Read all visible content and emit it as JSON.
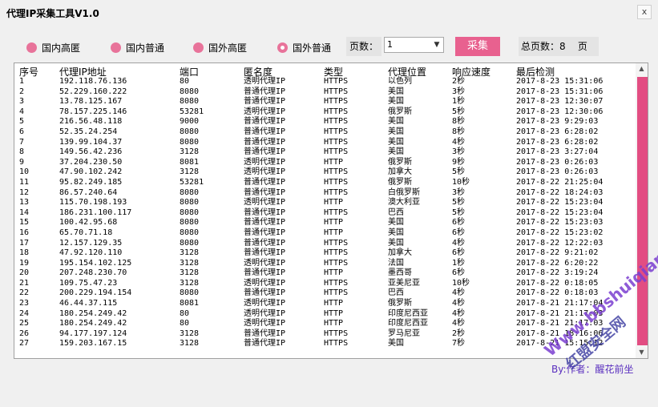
{
  "window": {
    "title": "代理IP采集工具V1.0",
    "close_label": "x"
  },
  "filters": [
    {
      "label": "国内高匿",
      "selected": false
    },
    {
      "label": "国内普通",
      "selected": false
    },
    {
      "label": "国外高匿",
      "selected": false
    },
    {
      "label": "国外普通",
      "selected": true
    }
  ],
  "page_label": "页数：",
  "page_select": {
    "value": "1"
  },
  "collect_button": "采集",
  "total_pages": {
    "prefix": "总页数：",
    "value": "8",
    "suffix": "页"
  },
  "table": {
    "columns": [
      "序号",
      "代理IP地址",
      "端口",
      "匿名度",
      "类型",
      "代理位置",
      "响应速度",
      "最后检测"
    ],
    "rows": [
      [
        "1",
        "192.118.76.136",
        "80",
        "透明代理IP",
        "HTTPS",
        "以色列",
        "2秒",
        "2017-8-23 15:31:06"
      ],
      [
        "2",
        "52.229.160.222",
        "8080",
        "普通代理IP",
        "HTTPS",
        "美国",
        "3秒",
        "2017-8-23 15:31:06"
      ],
      [
        "3",
        "13.78.125.167",
        "8080",
        "普通代理IP",
        "HTTPS",
        "美国",
        "1秒",
        "2017-8-23 12:30:07"
      ],
      [
        "4",
        "78.157.225.146",
        "53281",
        "透明代理IP",
        "HTTPS",
        "俄罗斯",
        "5秒",
        "2017-8-23 12:30:06"
      ],
      [
        "5",
        "216.56.48.118",
        "9000",
        "普通代理IP",
        "HTTPS",
        "美国",
        "8秒",
        "2017-8-23 9:29:03"
      ],
      [
        "6",
        "52.35.24.254",
        "8080",
        "普通代理IP",
        "HTTPS",
        "美国",
        "8秒",
        "2017-8-23 6:28:02"
      ],
      [
        "7",
        "139.99.104.37",
        "8080",
        "普通代理IP",
        "HTTPS",
        "美国",
        "4秒",
        "2017-8-23 6:28:02"
      ],
      [
        "8",
        "149.56.42.236",
        "3128",
        "普通代理IP",
        "HTTPS",
        "美国",
        "3秒",
        "2017-8-23 3:27:04"
      ],
      [
        "9",
        "37.204.230.50",
        "8081",
        "透明代理IP",
        "HTTP",
        "俄罗斯",
        "9秒",
        "2017-8-23 0:26:03"
      ],
      [
        "10",
        "47.90.102.242",
        "3128",
        "透明代理IP",
        "HTTPS",
        "加拿大",
        "5秒",
        "2017-8-23 0:26:03"
      ],
      [
        "11",
        "95.82.249.185",
        "53281",
        "普通代理IP",
        "HTTPS",
        "俄罗斯",
        "10秒",
        "2017-8-22 21:25:04"
      ],
      [
        "12",
        "86.57.240.64",
        "8080",
        "普通代理IP",
        "HTTPS",
        "白俄罗斯",
        "3秒",
        "2017-8-22 18:24:03"
      ],
      [
        "13",
        "115.70.198.193",
        "8080",
        "透明代理IP",
        "HTTP",
        "澳大利亚",
        "5秒",
        "2017-8-22 15:23:04"
      ],
      [
        "14",
        "186.231.100.117",
        "8080",
        "普通代理IP",
        "HTTPS",
        "巴西",
        "5秒",
        "2017-8-22 15:23:04"
      ],
      [
        "15",
        "100.42.95.68",
        "8080",
        "普通代理IP",
        "HTTP",
        "美国",
        "6秒",
        "2017-8-22 15:23:03"
      ],
      [
        "16",
        "65.70.71.18",
        "8080",
        "普通代理IP",
        "HTTP",
        "美国",
        "6秒",
        "2017-8-22 15:23:02"
      ],
      [
        "17",
        "12.157.129.35",
        "8080",
        "普通代理IP",
        "HTTPS",
        "美国",
        "4秒",
        "2017-8-22 12:22:03"
      ],
      [
        "18",
        "47.92.120.110",
        "3128",
        "普通代理IP",
        "HTTPS",
        "加拿大",
        "6秒",
        "2017-8-22 9:21:02"
      ],
      [
        "19",
        "195.154.102.125",
        "3128",
        "透明代理IP",
        "HTTPS",
        "法国",
        "1秒",
        "2017-8-22 6:20:22"
      ],
      [
        "20",
        "207.248.230.70",
        "3128",
        "普通代理IP",
        "HTTP",
        "墨西哥",
        "6秒",
        "2017-8-22 3:19:24"
      ],
      [
        "21",
        "109.75.47.23",
        "3128",
        "透明代理IP",
        "HTTPS",
        "亚美尼亚",
        "10秒",
        "2017-8-22 0:18:05"
      ],
      [
        "22",
        "200.229.194.154",
        "8080",
        "普通代理IP",
        "HTTPS",
        "巴西",
        "4秒",
        "2017-8-22 0:18:03"
      ],
      [
        "23",
        "46.44.37.115",
        "8081",
        "透明代理IP",
        "HTTP",
        "俄罗斯",
        "4秒",
        "2017-8-21 21:17:04"
      ],
      [
        "24",
        "180.254.249.42",
        "80",
        "透明代理IP",
        "HTTP",
        "印度尼西亚",
        "4秒",
        "2017-8-21 21:17:03"
      ],
      [
        "25",
        "180.254.249.42",
        "80",
        "透明代理IP",
        "HTTP",
        "印度尼西亚",
        "4秒",
        "2017-8-21 21:17:03"
      ],
      [
        "26",
        "94.177.197.124",
        "3128",
        "普通代理IP",
        "HTTPS",
        "罗马尼亚",
        "2秒",
        "2017-8-21 18:16:06"
      ],
      [
        "27",
        "159.203.167.15",
        "3128",
        "普通代理IP",
        "HTTPS",
        "美国",
        "7秒",
        "2017-8-21 15:15:12"
      ]
    ]
  },
  "author": "By:作者：醒花前坐",
  "watermark": {
    "line1": "Www.bbshuiqian.com",
    "line2": "红盟安全网"
  },
  "colors": {
    "accent": "#e8618f",
    "radio": "#e8739a",
    "scrollbar": "#e24d82"
  }
}
